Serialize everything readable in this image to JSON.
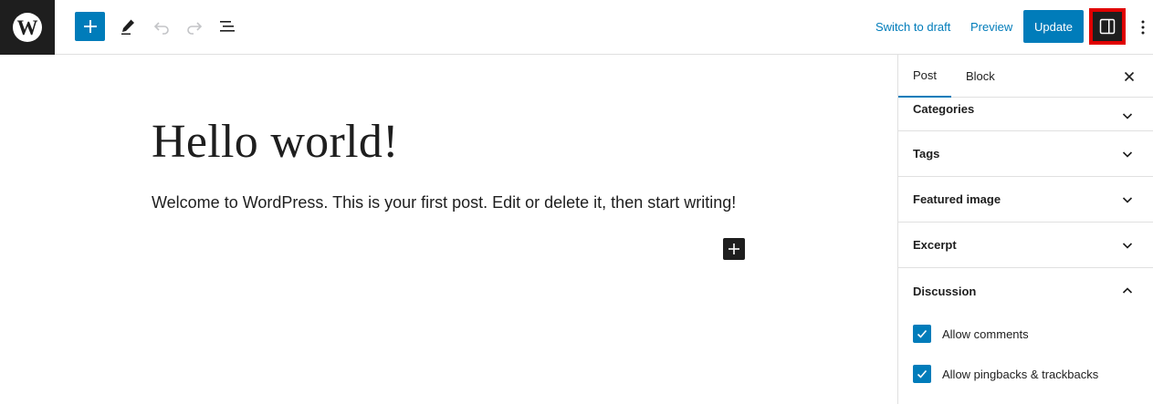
{
  "topbar": {
    "logo_letter": "W",
    "switch_to_draft": "Switch to draft",
    "preview": "Preview",
    "update": "Update"
  },
  "editor": {
    "title": "Hello world!",
    "paragraph": "Welcome to WordPress. This is your first post. Edit or delete it, then start writing!"
  },
  "sidebar": {
    "tabs": [
      {
        "label": "Post",
        "active": true
      },
      {
        "label": "Block",
        "active": false
      }
    ],
    "panels": [
      {
        "label": "Categories",
        "expanded": false
      },
      {
        "label": "Tags",
        "expanded": false
      },
      {
        "label": "Featured image",
        "expanded": false
      },
      {
        "label": "Excerpt",
        "expanded": false
      },
      {
        "label": "Discussion",
        "expanded": true
      }
    ],
    "discussion_options": [
      {
        "label": "Allow comments",
        "checked": true
      },
      {
        "label": "Allow pingbacks & trackbacks",
        "checked": true
      }
    ]
  },
  "colors": {
    "accent": "#007cba",
    "dark": "#1e1e1e",
    "highlight": "#e00000"
  }
}
